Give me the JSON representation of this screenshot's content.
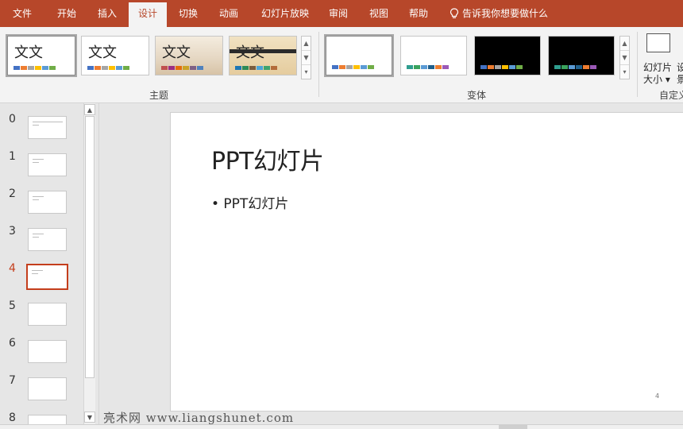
{
  "menu": {
    "tabs": [
      {
        "label": "文件"
      },
      {
        "label": "开始"
      },
      {
        "label": "插入"
      },
      {
        "label": "设计"
      },
      {
        "label": "切换"
      },
      {
        "label": "动画"
      },
      {
        "label": "幻灯片放映"
      },
      {
        "label": "审阅"
      },
      {
        "label": "视图"
      },
      {
        "label": "帮助"
      }
    ],
    "active_tab": "设计",
    "tell_me": "告诉我你想要做什么",
    "bar_color": "#b7472a"
  },
  "ribbon": {
    "themes": {
      "group_label": "主题",
      "items": [
        {
          "text": "文文",
          "swatches": [
            "#4472c4",
            "#ed7d31",
            "#a5a5a5",
            "#ffc000",
            "#5b9bd5",
            "#70ad47"
          ]
        },
        {
          "text": "文文",
          "swatches": [
            "#4472c4",
            "#ed7d31",
            "#a5a5a5",
            "#ffc000",
            "#5b9bd5",
            "#70ad47"
          ]
        },
        {
          "text": "文文",
          "swatches": [
            "#c0504d",
            "#9b2e82",
            "#e46c0a",
            "#c9a227",
            "#7f6084",
            "#4f81bd"
          ]
        },
        {
          "text": "文文",
          "swatches": [
            "#1f77b4",
            "#2e8b57",
            "#7a5c3d",
            "#4ba4d8",
            "#3da36e",
            "#b36b3a"
          ]
        }
      ]
    },
    "variants": {
      "group_label": "变体",
      "items": [
        {
          "bg": "#ffffff",
          "swatches": [
            "#4472c4",
            "#ed7d31",
            "#a5a5a5",
            "#ffc000",
            "#5b9bd5",
            "#70ad47"
          ]
        },
        {
          "bg": "#ffffff",
          "swatches": [
            "#2f9e8f",
            "#3aa35d",
            "#5b9bd5",
            "#1f5f8b",
            "#ed7d31",
            "#9b59b6"
          ]
        },
        {
          "bg": "#000000",
          "swatches": [
            "#4472c4",
            "#ed7d31",
            "#a5a5a5",
            "#ffc000",
            "#5b9bd5",
            "#70ad47"
          ]
        },
        {
          "bg": "#000000",
          "swatches": [
            "#2f9e8f",
            "#3aa35d",
            "#5b9bd5",
            "#1f5f8b",
            "#ed7d31",
            "#9b59b6"
          ]
        }
      ]
    },
    "customize": {
      "group_label": "自定义",
      "slide_size_label_1": "幻灯片",
      "slide_size_label_2": "大小 ▾",
      "format_bg_label_1": "设",
      "format_bg_label_2": "景"
    }
  },
  "thumbnails": {
    "current": 4,
    "items": [
      {
        "number": "0"
      },
      {
        "number": "1"
      },
      {
        "number": "2"
      },
      {
        "number": "3"
      },
      {
        "number": "4"
      },
      {
        "number": "5"
      },
      {
        "number": "6"
      },
      {
        "number": "7"
      },
      {
        "number": "8"
      }
    ],
    "accent_color": "#c43e1c"
  },
  "slide": {
    "title": "PPT幻灯片",
    "body": "• PPT幻灯片",
    "number": "4"
  },
  "watermark": "亮术网 www.liangshunet.com"
}
